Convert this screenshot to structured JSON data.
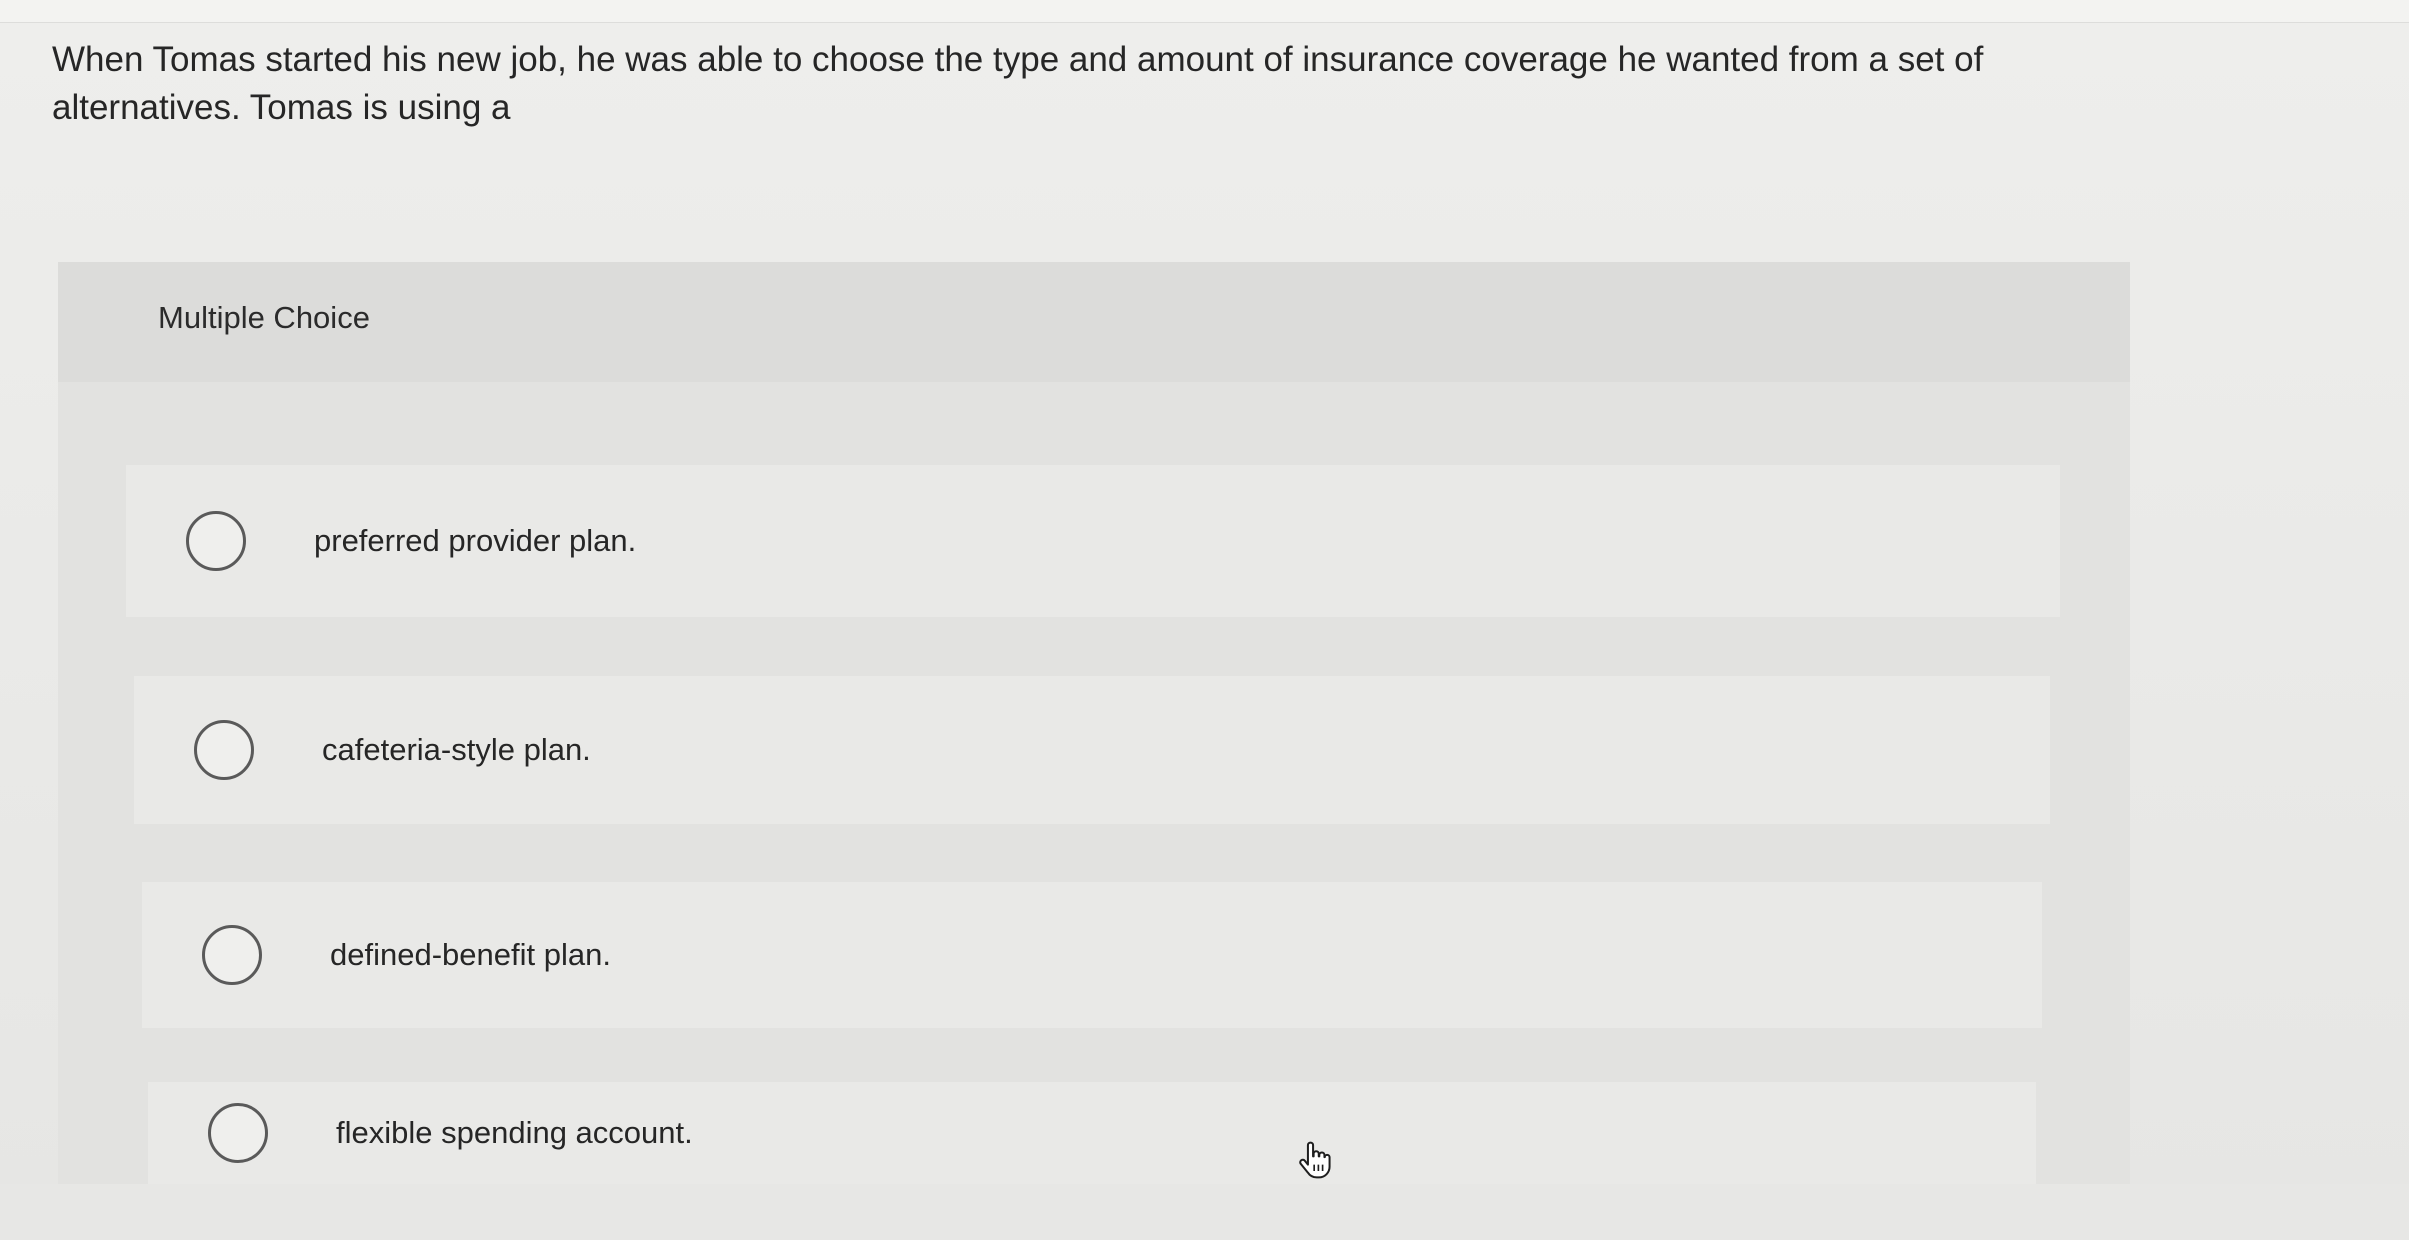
{
  "question": {
    "text": "When Tomas started his new job, he was able to choose the type and amount of insurance coverage he wanted from a set of alternatives. Tomas is using a"
  },
  "multiple_choice": {
    "title": "Multiple Choice",
    "options": [
      {
        "label": "preferred provider plan.",
        "selected": false
      },
      {
        "label": "cafeteria-style plan.",
        "selected": false
      },
      {
        "label": "defined-benefit plan.",
        "selected": false
      },
      {
        "label": "flexible spending account.",
        "selected": false
      }
    ]
  },
  "cursor": {
    "icon": "hand-pointer-icon"
  }
}
